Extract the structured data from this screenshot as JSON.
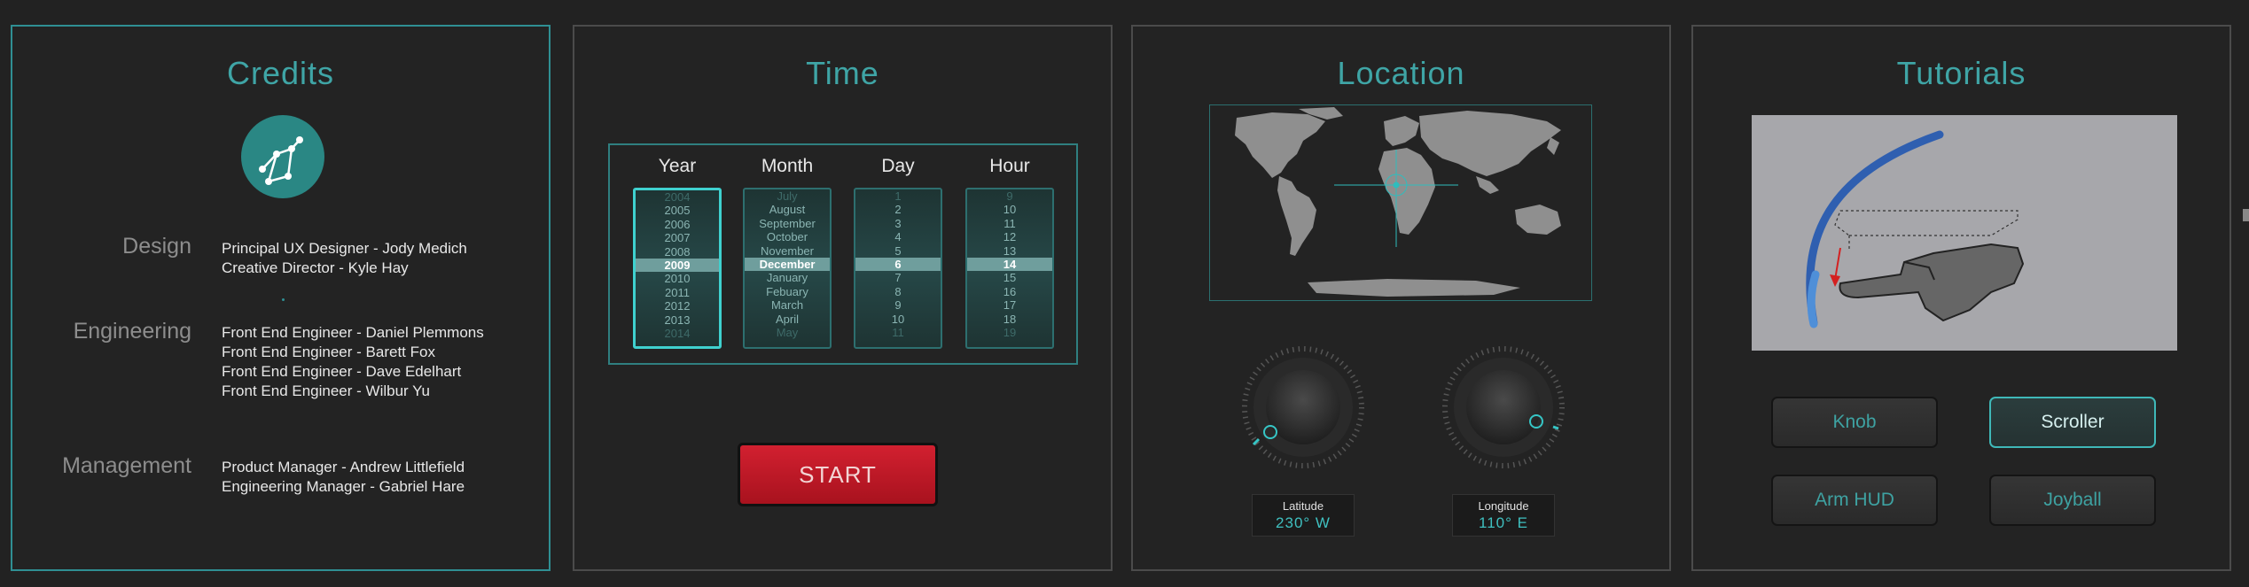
{
  "panels": {
    "credits": {
      "title": "Credits",
      "sections": [
        {
          "heading": "Design",
          "names": [
            "Principal UX Designer - Jody Medich",
            "Creative Director - Kyle Hay"
          ]
        },
        {
          "heading": "Engineering",
          "names": [
            "Front End Engineer - Daniel Plemmons",
            "Front End Engineer - Barett Fox",
            "Front End Engineer - Dave Edelhart",
            "Front End Engineer - Wilbur Yu"
          ]
        },
        {
          "heading": "Management",
          "names": [
            "Product Manager - Andrew Littlefield",
            "Engineering Manager - Gabriel Hare"
          ]
        }
      ]
    },
    "time": {
      "title": "Time",
      "columns": [
        {
          "label": "Year",
          "items": [
            "2004",
            "2005",
            "2006",
            "2007",
            "2008",
            "2009",
            "2010",
            "2011",
            "2012",
            "2013",
            "2014"
          ],
          "selected": 5
        },
        {
          "label": "Month",
          "items": [
            "July",
            "August",
            "September",
            "October",
            "November",
            "December",
            "January",
            "Febuary",
            "March",
            "April",
            "May"
          ],
          "selected": 5
        },
        {
          "label": "Day",
          "items": [
            "1",
            "2",
            "3",
            "4",
            "5",
            "6",
            "7",
            "8",
            "9",
            "10",
            "11"
          ],
          "selected": 5
        },
        {
          "label": "Hour",
          "items": [
            "9",
            "10",
            "11",
            "12",
            "13",
            "14",
            "15",
            "16",
            "17",
            "18",
            "19"
          ],
          "selected": 5
        }
      ],
      "start_label": "START"
    },
    "location": {
      "title": "Location",
      "latitude": {
        "label": "Latitude",
        "value": "230° W"
      },
      "longitude": {
        "label": "Longitude",
        "value": "110° E"
      }
    },
    "tutorials": {
      "title": "Tutorials",
      "buttons": [
        "Knob",
        "Scroller",
        "Arm HUD",
        "Joyball"
      ],
      "active": "Scroller"
    }
  },
  "colors": {
    "accent": "#3fa5a6",
    "start": "#c01a27",
    "background": "#222222"
  },
  "icons": {
    "credits_logo": "constellation-icon",
    "map_marker": "crosshair-icon"
  }
}
